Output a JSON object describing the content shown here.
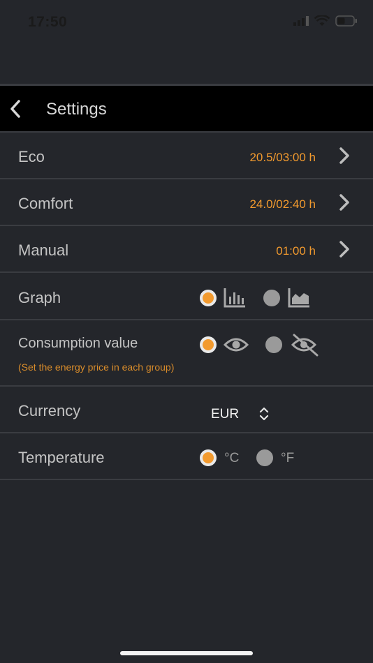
{
  "status": {
    "time": "17:50"
  },
  "nav": {
    "title": "Settings"
  },
  "rows": {
    "eco": {
      "label": "Eco",
      "value": "20.5/03:00 h"
    },
    "comfort": {
      "label": "Comfort",
      "value": "24.0/02:40 h"
    },
    "manual": {
      "label": "Manual",
      "value": "01:00 h"
    },
    "graph": {
      "label": "Graph",
      "options": [
        "bar-chart-icon",
        "area-chart-icon"
      ],
      "selected_index": 0
    },
    "consumption": {
      "label": "Consumption value",
      "note": "(Set the energy price in each group)",
      "options": [
        "eye-icon",
        "eye-slash-icon"
      ],
      "selected_index": 0
    },
    "currency": {
      "label": "Currency",
      "value": "EUR"
    },
    "temperature": {
      "label": "Temperature",
      "options": [
        "°C",
        "°F"
      ],
      "selected_index": 0
    }
  },
  "colors": {
    "accent": "#f29a2e",
    "background": "#24262b",
    "navbar": "#000000"
  }
}
